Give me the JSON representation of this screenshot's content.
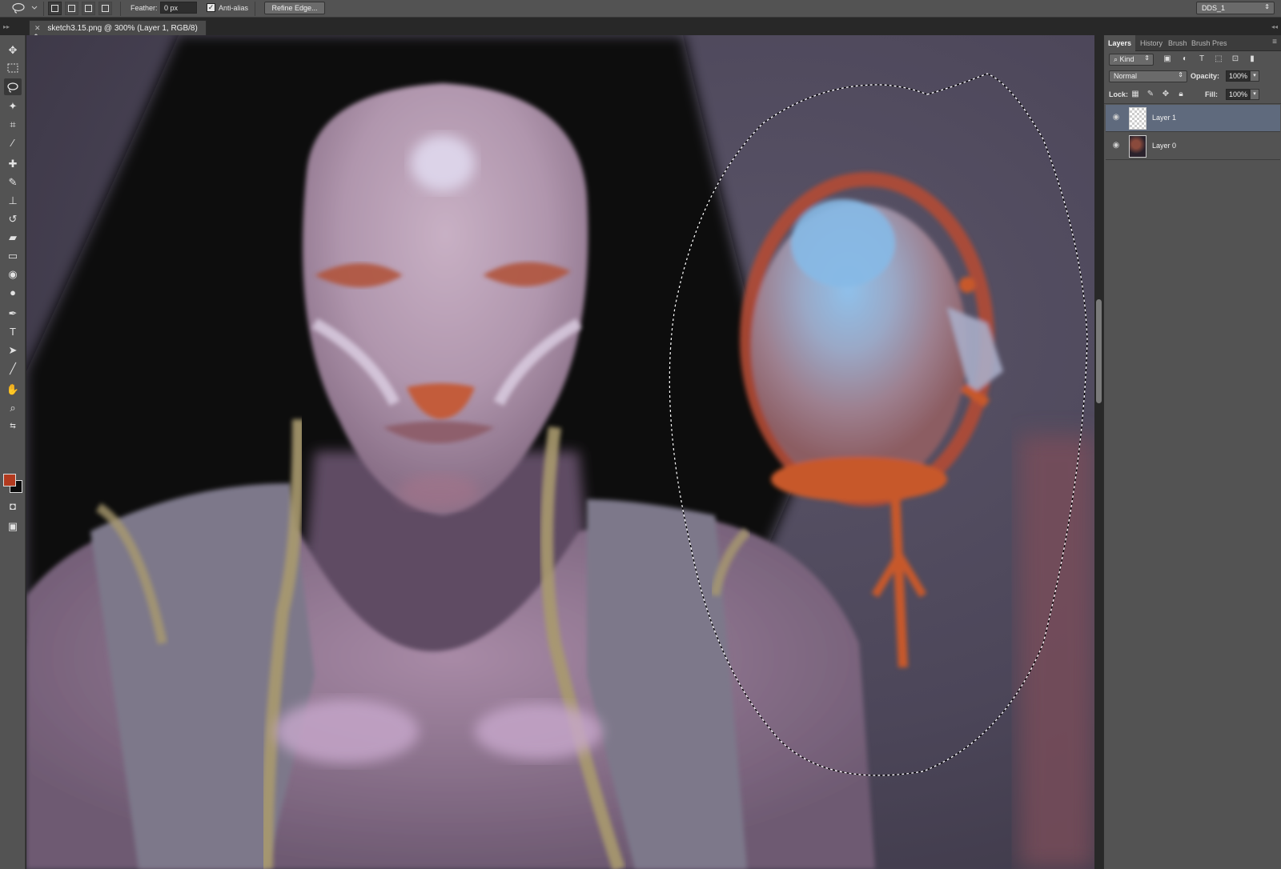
{
  "options_bar": {
    "feather_label": "Feather:",
    "feather_value": "0 px",
    "antialias_label": "Anti-alias",
    "antialias_checked": true,
    "refine_edge_label": "Refine Edge...",
    "workspace_value": "DDS_1"
  },
  "document": {
    "tab_title": "sketch3.15.png @ 300% (Layer 1, RGB/8) *"
  },
  "tools": {
    "foreground_color": "#b23a1f",
    "background_color": "#0c0c0c"
  },
  "panels": {
    "tabs": [
      {
        "label": "Layers",
        "active": true
      },
      {
        "label": "History",
        "active": false
      },
      {
        "label": "Brush",
        "active": false
      },
      {
        "label": "Brush Pres",
        "active": false
      }
    ],
    "filter_kind": "Kind",
    "blend_mode": "Normal",
    "opacity_label": "Opacity:",
    "opacity_value": "100%",
    "lock_label": "Lock:",
    "fill_label": "Fill:",
    "fill_value": "100%",
    "layers": [
      {
        "name": "Layer 1",
        "selected": true
      },
      {
        "name": "Layer 0",
        "selected": false
      }
    ]
  }
}
